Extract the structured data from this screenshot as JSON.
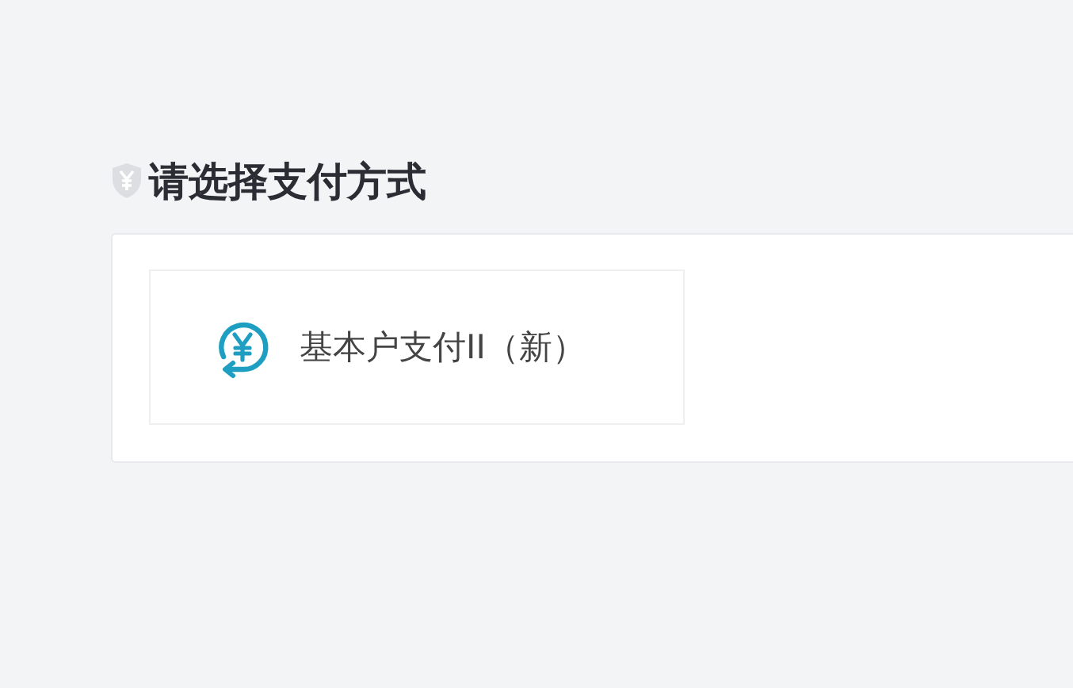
{
  "heading": "请选择支付方式",
  "payment_methods": [
    {
      "label": "基本户支付II（新）",
      "selected": false
    }
  ]
}
